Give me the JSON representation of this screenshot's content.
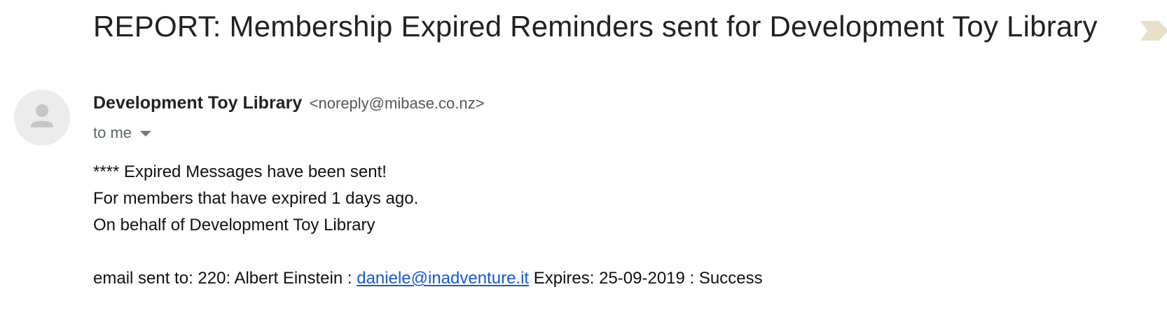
{
  "email": {
    "subject": "REPORT: Membership Expired Reminders sent for Development Toy Library",
    "label_tag_icon": "importance-marker-icon",
    "sender": {
      "name": "Development Toy Library",
      "email": "<noreply@mibase.co.nz>"
    },
    "recipient_label": "to me",
    "body": {
      "line1": "**** Expired Messages have been sent!",
      "line2": "For members that have expired 1 days ago.",
      "line3": "On behalf of Development Toy Library",
      "report_prefix": "email sent to: 220: Albert Einstein : ",
      "report_link": "daniele@inadventure.it",
      "report_suffix": " Expires: 25-09-2019 : Success"
    }
  },
  "colors": {
    "link": "#1a56cc",
    "tag": "#e8dfc9",
    "avatar_bg": "#ececec",
    "avatar_fg": "#c6c6c6"
  }
}
